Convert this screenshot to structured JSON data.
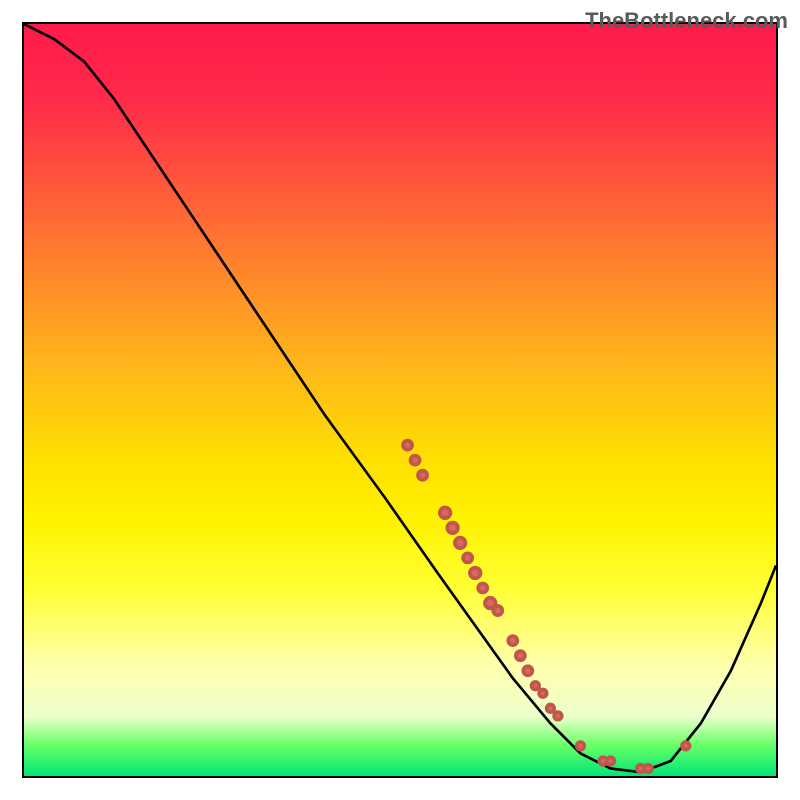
{
  "watermark": "TheBottleneck.com",
  "chart_data": {
    "type": "line",
    "title": "",
    "xlabel": "",
    "ylabel": "",
    "xlim": [
      0,
      100
    ],
    "ylim": [
      0,
      100
    ],
    "curve": [
      {
        "x": 0,
        "y": 100
      },
      {
        "x": 4,
        "y": 98
      },
      {
        "x": 8,
        "y": 95
      },
      {
        "x": 12,
        "y": 90
      },
      {
        "x": 20,
        "y": 78
      },
      {
        "x": 30,
        "y": 63
      },
      {
        "x": 40,
        "y": 48
      },
      {
        "x": 48,
        "y": 37
      },
      {
        "x": 55,
        "y": 27
      },
      {
        "x": 60,
        "y": 20
      },
      {
        "x": 65,
        "y": 13
      },
      {
        "x": 70,
        "y": 7
      },
      {
        "x": 74,
        "y": 3
      },
      {
        "x": 78,
        "y": 1
      },
      {
        "x": 82,
        "y": 0.5
      },
      {
        "x": 86,
        "y": 2
      },
      {
        "x": 90,
        "y": 7
      },
      {
        "x": 94,
        "y": 14
      },
      {
        "x": 98,
        "y": 23
      },
      {
        "x": 100,
        "y": 28
      }
    ],
    "scatter_points": [
      {
        "x": 51,
        "y": 44,
        "r": 6
      },
      {
        "x": 52,
        "y": 42,
        "r": 6
      },
      {
        "x": 53,
        "y": 40,
        "r": 6
      },
      {
        "x": 56,
        "y": 35,
        "r": 7
      },
      {
        "x": 57,
        "y": 33,
        "r": 7
      },
      {
        "x": 58,
        "y": 31,
        "r": 7
      },
      {
        "x": 59,
        "y": 29,
        "r": 6
      },
      {
        "x": 60,
        "y": 27,
        "r": 7
      },
      {
        "x": 61,
        "y": 25,
        "r": 6
      },
      {
        "x": 62,
        "y": 23,
        "r": 7
      },
      {
        "x": 63,
        "y": 22,
        "r": 6
      },
      {
        "x": 65,
        "y": 18,
        "r": 6
      },
      {
        "x": 66,
        "y": 16,
        "r": 6
      },
      {
        "x": 67,
        "y": 14,
        "r": 6
      },
      {
        "x": 68,
        "y": 12,
        "r": 5
      },
      {
        "x": 69,
        "y": 11,
        "r": 5
      },
      {
        "x": 70,
        "y": 9,
        "r": 5
      },
      {
        "x": 71,
        "y": 8,
        "r": 5
      },
      {
        "x": 74,
        "y": 4,
        "r": 5
      },
      {
        "x": 77,
        "y": 2,
        "r": 5
      },
      {
        "x": 78,
        "y": 2,
        "r": 5
      },
      {
        "x": 82,
        "y": 1,
        "r": 5
      },
      {
        "x": 83,
        "y": 1,
        "r": 5
      },
      {
        "x": 88,
        "y": 4,
        "r": 5
      }
    ]
  }
}
